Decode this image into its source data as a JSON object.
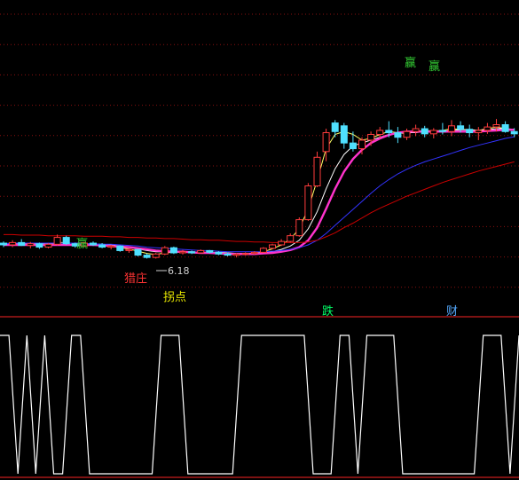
{
  "chart_data": [
    {
      "type": "candlestick",
      "price_label": "6.18",
      "annotations": [
        {
          "text": "赢",
          "color": "#33cc33"
        },
        {
          "text": "赢",
          "color": "#33cc33"
        },
        {
          "text": "赢",
          "color": "#33cc33"
        },
        {
          "text": "猎庄",
          "color": "#ff3333"
        },
        {
          "text": "拐点",
          "color": "#e8e800"
        },
        {
          "text": "跌",
          "color": "#00ff66"
        },
        {
          "text": "财",
          "color": "#55aaff"
        }
      ],
      "candles": [
        {
          "o": 6.45,
          "h": 6.48,
          "l": 6.38,
          "c": 6.42,
          "up": false
        },
        {
          "o": 6.42,
          "h": 6.5,
          "l": 6.38,
          "c": 6.46,
          "up": true
        },
        {
          "o": 6.46,
          "h": 6.52,
          "l": 6.4,
          "c": 6.41,
          "up": false
        },
        {
          "o": 6.41,
          "h": 6.47,
          "l": 6.36,
          "c": 6.44,
          "up": true
        },
        {
          "o": 6.44,
          "h": 6.46,
          "l": 6.35,
          "c": 6.38,
          "up": false
        },
        {
          "o": 6.38,
          "h": 6.45,
          "l": 6.36,
          "c": 6.43,
          "up": true
        },
        {
          "o": 6.43,
          "h": 6.6,
          "l": 6.41,
          "c": 6.55,
          "up": true
        },
        {
          "o": 6.55,
          "h": 6.58,
          "l": 6.42,
          "c": 6.44,
          "up": false
        },
        {
          "o": 6.44,
          "h": 6.46,
          "l": 6.37,
          "c": 6.4,
          "up": false
        },
        {
          "o": 6.4,
          "h": 6.47,
          "l": 6.38,
          "c": 6.45,
          "up": true
        },
        {
          "o": 6.45,
          "h": 6.48,
          "l": 6.4,
          "c": 6.42,
          "up": false
        },
        {
          "o": 6.42,
          "h": 6.45,
          "l": 6.36,
          "c": 6.38,
          "up": false
        },
        {
          "o": 6.38,
          "h": 6.42,
          "l": 6.34,
          "c": 6.4,
          "up": true
        },
        {
          "o": 6.4,
          "h": 6.41,
          "l": 6.3,
          "c": 6.32,
          "up": false
        },
        {
          "o": 6.32,
          "h": 6.36,
          "l": 6.28,
          "c": 6.34,
          "up": true
        },
        {
          "o": 6.34,
          "h": 6.35,
          "l": 6.22,
          "c": 6.24,
          "up": false
        },
        {
          "o": 6.24,
          "h": 6.27,
          "l": 6.18,
          "c": 6.2,
          "up": false
        },
        {
          "o": 6.2,
          "h": 6.28,
          "l": 6.18,
          "c": 6.26,
          "up": true
        },
        {
          "o": 6.26,
          "h": 6.4,
          "l": 6.24,
          "c": 6.37,
          "up": true
        },
        {
          "o": 6.37,
          "h": 6.39,
          "l": 6.26,
          "c": 6.28,
          "up": false
        },
        {
          "o": 6.28,
          "h": 6.33,
          "l": 6.25,
          "c": 6.3,
          "up": true
        },
        {
          "o": 6.3,
          "h": 6.32,
          "l": 6.26,
          "c": 6.28,
          "up": false
        },
        {
          "o": 6.28,
          "h": 6.34,
          "l": 6.27,
          "c": 6.32,
          "up": true
        },
        {
          "o": 6.32,
          "h": 6.33,
          "l": 6.27,
          "c": 6.29,
          "up": false
        },
        {
          "o": 6.29,
          "h": 6.31,
          "l": 6.24,
          "c": 6.26,
          "up": false
        },
        {
          "o": 6.26,
          "h": 6.29,
          "l": 6.22,
          "c": 6.24,
          "up": false
        },
        {
          "o": 6.24,
          "h": 6.28,
          "l": 6.2,
          "c": 6.26,
          "up": true
        },
        {
          "o": 6.26,
          "h": 6.29,
          "l": 6.23,
          "c": 6.27,
          "up": true
        },
        {
          "o": 6.27,
          "h": 6.31,
          "l": 6.25,
          "c": 6.29,
          "up": true
        },
        {
          "o": 6.29,
          "h": 6.38,
          "l": 6.28,
          "c": 6.36,
          "up": true
        },
        {
          "o": 6.36,
          "h": 6.44,
          "l": 6.34,
          "c": 6.42,
          "up": true
        },
        {
          "o": 6.42,
          "h": 6.52,
          "l": 6.4,
          "c": 6.48,
          "up": true
        },
        {
          "o": 6.48,
          "h": 6.62,
          "l": 6.46,
          "c": 6.58,
          "up": true
        },
        {
          "o": 6.58,
          "h": 6.9,
          "l": 6.56,
          "c": 6.86,
          "up": true
        },
        {
          "o": 6.86,
          "h": 7.5,
          "l": 6.84,
          "c": 7.45,
          "up": true
        },
        {
          "o": 7.45,
          "h": 8.05,
          "l": 7.43,
          "c": 7.95,
          "up": true
        },
        {
          "o": 8.05,
          "h": 8.45,
          "l": 7.88,
          "c": 8.38,
          "up": true
        },
        {
          "o": 8.4,
          "h": 8.6,
          "l": 8.3,
          "c": 8.55,
          "up": false
        },
        {
          "o": 8.5,
          "h": 8.55,
          "l": 8.1,
          "c": 8.2,
          "up": false
        },
        {
          "o": 8.2,
          "h": 8.4,
          "l": 8.05,
          "c": 8.1,
          "up": false
        },
        {
          "o": 8.1,
          "h": 8.3,
          "l": 8.0,
          "c": 8.25,
          "up": true
        },
        {
          "o": 8.25,
          "h": 8.4,
          "l": 8.15,
          "c": 8.35,
          "up": true
        },
        {
          "o": 8.35,
          "h": 8.48,
          "l": 8.28,
          "c": 8.42,
          "up": true
        },
        {
          "o": 8.42,
          "h": 8.58,
          "l": 8.3,
          "c": 8.38,
          "up": false
        },
        {
          "o": 8.38,
          "h": 8.48,
          "l": 8.2,
          "c": 8.3,
          "up": false
        },
        {
          "o": 8.3,
          "h": 8.45,
          "l": 8.25,
          "c": 8.4,
          "up": true
        },
        {
          "o": 8.4,
          "h": 8.52,
          "l": 8.32,
          "c": 8.45,
          "up": true
        },
        {
          "o": 8.45,
          "h": 8.5,
          "l": 8.3,
          "c": 8.36,
          "up": false
        },
        {
          "o": 8.36,
          "h": 8.46,
          "l": 8.28,
          "c": 8.42,
          "up": true
        },
        {
          "o": 8.42,
          "h": 8.55,
          "l": 8.35,
          "c": 8.4,
          "up": false
        },
        {
          "o": 8.4,
          "h": 8.6,
          "l": 8.32,
          "c": 8.5,
          "up": true
        },
        {
          "o": 8.5,
          "h": 8.58,
          "l": 8.38,
          "c": 8.44,
          "up": false
        },
        {
          "o": 8.44,
          "h": 8.52,
          "l": 8.3,
          "c": 8.38,
          "up": false
        },
        {
          "o": 8.38,
          "h": 8.48,
          "l": 8.25,
          "c": 8.42,
          "up": true
        },
        {
          "o": 8.42,
          "h": 8.55,
          "l": 8.36,
          "c": 8.48,
          "up": true
        },
        {
          "o": 8.48,
          "h": 8.62,
          "l": 8.4,
          "c": 8.52,
          "up": true
        },
        {
          "o": 8.52,
          "h": 8.58,
          "l": 8.38,
          "c": 8.4,
          "up": false
        },
        {
          "o": 8.4,
          "h": 8.46,
          "l": 8.3,
          "c": 8.36,
          "up": false
        }
      ],
      "series": [
        {
          "color": "#ffff66",
          "values": [
            6.44,
            6.45,
            6.44,
            6.45,
            6.44,
            6.43,
            6.46,
            6.46,
            6.44,
            6.43,
            6.43,
            6.41,
            6.4,
            6.37,
            6.35,
            6.31,
            6.27,
            6.25,
            6.28,
            6.29,
            6.29,
            6.3,
            6.29,
            6.29,
            6.28,
            6.27,
            6.26,
            6.26,
            6.27,
            6.3,
            6.35,
            6.42,
            6.52,
            6.7,
            7.05,
            7.55,
            8.1,
            8.35,
            8.4,
            8.35,
            8.25,
            8.28,
            8.35,
            8.4,
            8.38,
            8.36,
            8.4,
            8.42,
            8.41,
            8.42,
            8.45,
            8.44,
            8.43,
            8.42,
            8.45,
            8.48,
            8.45,
            8.42
          ]
        },
        {
          "color": "#ffffff",
          "values": [
            6.43,
            6.44,
            6.44,
            6.44,
            6.44,
            6.44,
            6.45,
            6.45,
            6.45,
            6.44,
            6.44,
            6.43,
            6.42,
            6.4,
            6.38,
            6.35,
            6.32,
            6.3,
            6.3,
            6.3,
            6.3,
            6.29,
            6.29,
            6.29,
            6.29,
            6.28,
            6.27,
            6.27,
            6.27,
            6.28,
            6.3,
            6.34,
            6.4,
            6.5,
            6.7,
            7.0,
            7.4,
            7.75,
            8.0,
            8.15,
            8.2,
            8.25,
            8.3,
            8.35,
            8.37,
            8.38,
            8.38,
            8.4,
            8.4,
            8.41,
            8.42,
            8.43,
            8.43,
            8.42,
            8.43,
            8.45,
            8.45,
            8.44
          ]
        },
        {
          "color": "#ff33cc",
          "values": [
            6.42,
            6.42,
            6.42,
            6.42,
            6.42,
            6.42,
            6.42,
            6.42,
            6.42,
            6.42,
            6.42,
            6.41,
            6.4,
            6.39,
            6.38,
            6.36,
            6.34,
            6.32,
            6.31,
            6.3,
            6.3,
            6.29,
            6.28,
            6.28,
            6.27,
            6.26,
            6.26,
            6.26,
            6.26,
            6.27,
            6.28,
            6.3,
            6.33,
            6.38,
            6.5,
            6.72,
            7.05,
            7.4,
            7.7,
            7.92,
            8.08,
            8.2,
            8.28,
            8.34,
            8.38,
            8.4,
            8.4,
            8.4,
            8.4,
            8.4,
            8.4,
            8.4,
            8.4,
            8.4,
            8.41,
            8.42,
            8.43,
            8.43
          ]
        },
        {
          "color": "#3333ff",
          "values": [
            6.44,
            6.45,
            6.45,
            6.45,
            6.45,
            6.45,
            6.45,
            6.45,
            6.45,
            6.44,
            6.44,
            6.43,
            6.43,
            6.42,
            6.41,
            6.4,
            6.38,
            6.37,
            6.36,
            6.35,
            6.34,
            6.33,
            6.32,
            6.32,
            6.31,
            6.3,
            6.3,
            6.3,
            6.3,
            6.3,
            6.31,
            6.32,
            6.34,
            6.37,
            6.42,
            6.5,
            6.62,
            6.76,
            6.9,
            7.04,
            7.18,
            7.32,
            7.45,
            7.56,
            7.66,
            7.74,
            7.81,
            7.87,
            7.92,
            7.97,
            8.02,
            8.07,
            8.12,
            8.16,
            8.2,
            8.24,
            8.28,
            8.31
          ]
        },
        {
          "color": "#cc0000",
          "values": [
            6.6,
            6.6,
            6.59,
            6.59,
            6.59,
            6.58,
            6.58,
            6.58,
            6.58,
            6.57,
            6.57,
            6.57,
            6.56,
            6.56,
            6.55,
            6.55,
            6.54,
            6.54,
            6.53,
            6.53,
            6.52,
            6.51,
            6.51,
            6.5,
            6.5,
            6.49,
            6.48,
            6.48,
            6.47,
            6.47,
            6.46,
            6.46,
            6.46,
            6.46,
            6.47,
            6.5,
            6.56,
            6.63,
            6.72,
            6.8,
            6.89,
            6.98,
            7.06,
            7.13,
            7.2,
            7.27,
            7.33,
            7.39,
            7.45,
            7.51,
            7.56,
            7.61,
            7.66,
            7.71,
            7.75,
            7.79,
            7.83,
            7.87
          ]
        }
      ]
    },
    {
      "type": "line",
      "color": "#ffffff",
      "values": [
        1,
        1,
        0,
        1,
        0,
        1,
        0,
        0,
        1,
        1,
        0,
        0,
        0,
        0,
        0,
        0,
        0,
        0,
        1,
        1,
        1,
        0,
        0,
        0,
        0,
        0,
        0,
        1,
        1,
        1,
        1,
        1,
        1,
        1,
        1,
        0,
        0,
        0,
        1,
        1,
        0,
        1,
        1,
        1,
        1,
        0,
        0,
        0,
        0,
        0,
        0,
        0,
        0,
        0,
        1,
        1,
        1,
        0,
        1
      ]
    }
  ]
}
